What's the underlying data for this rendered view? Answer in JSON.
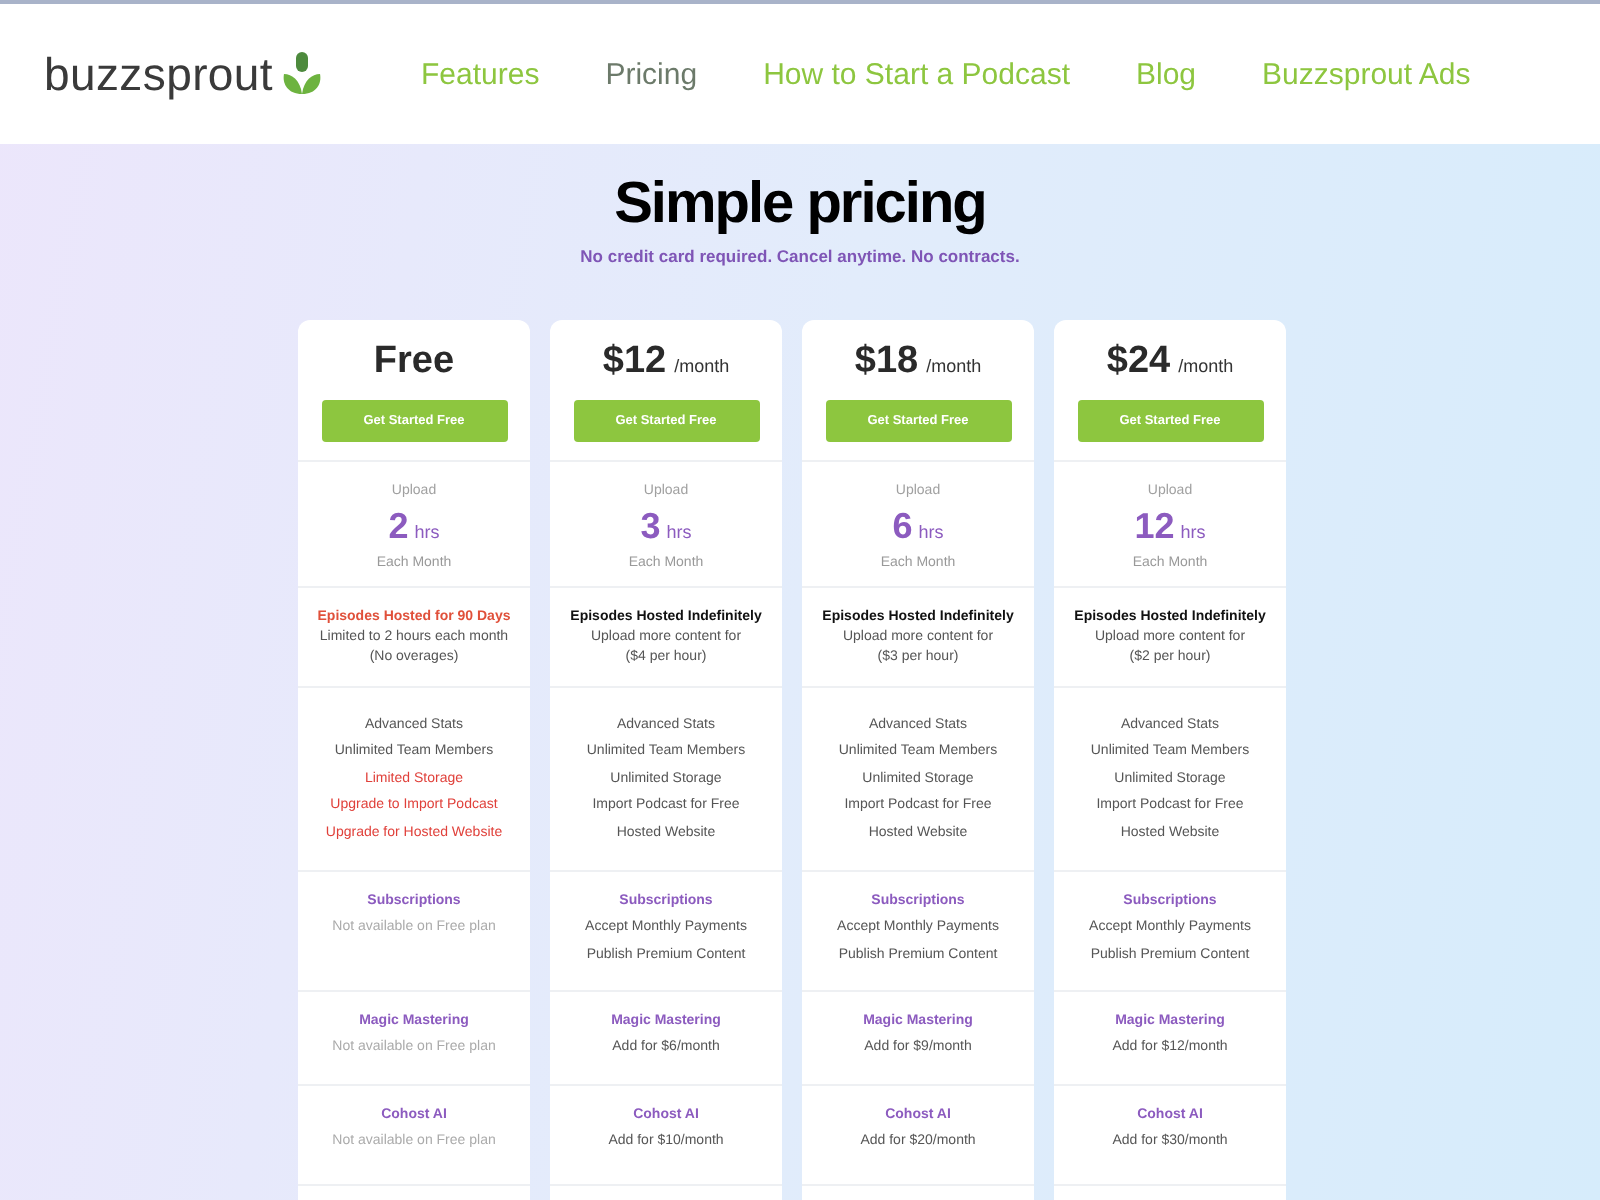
{
  "header": {
    "logo": "buzzsprout",
    "nav": [
      {
        "label": "Features",
        "selected": false
      },
      {
        "label": "Pricing",
        "selected": true
      },
      {
        "label": "How to Start a Podcast",
        "selected": false
      },
      {
        "label": "Blog",
        "selected": false
      },
      {
        "label": "Buzzsprout Ads",
        "selected": false
      }
    ]
  },
  "hero": {
    "title": "Simple pricing",
    "subtitle": "No credit card required. Cancel anytime. No contracts."
  },
  "plans": [
    {
      "price": "Free",
      "button": "Get Started Free",
      "upload": {
        "label": "Upload",
        "amount": "2",
        "unit": "hrs",
        "note": "Each Month"
      },
      "hosting": {
        "title": "Episodes Hosted for 90 Days",
        "limited": true,
        "lines": [
          "Limited to 2 hours each month",
          "(No overages)"
        ]
      },
      "features": [
        {
          "text": "Advanced Stats",
          "limited": false
        },
        {
          "text": "Unlimited Team Members",
          "limited": false
        },
        {
          "text": "Limited Storage",
          "limited": true
        },
        {
          "text": "Upgrade to Import Podcast",
          "limited": true
        },
        {
          "text": "Upgrade for Hosted Website",
          "limited": true
        }
      ],
      "addons": [
        {
          "title": "Subscriptions",
          "lines": [
            {
              "text": "Not available on Free plan",
              "available": false
            }
          ]
        },
        {
          "title": "Magic Mastering",
          "lines": [
            {
              "text": "Not available on Free plan",
              "available": false
            }
          ]
        },
        {
          "title": "Cohost AI",
          "lines": [
            {
              "text": "Not available on Free plan",
              "available": false
            }
          ]
        }
      ]
    },
    {
      "price": "$12",
      "period": "/month",
      "button": "Get Started Free",
      "upload": {
        "label": "Upload",
        "amount": "3",
        "unit": "hrs",
        "note": "Each Month"
      },
      "hosting": {
        "title": "Episodes Hosted Indefinitely",
        "limited": false,
        "lines": [
          "Upload more content for",
          "($4 per hour)"
        ]
      },
      "features": [
        {
          "text": "Advanced Stats",
          "limited": false
        },
        {
          "text": "Unlimited Team Members",
          "limited": false
        },
        {
          "text": "Unlimited Storage",
          "limited": false
        },
        {
          "text": "Import Podcast for Free",
          "limited": false
        },
        {
          "text": "Hosted Website",
          "limited": false
        }
      ],
      "addons": [
        {
          "title": "Subscriptions",
          "lines": [
            {
              "text": "Accept Monthly Payments",
              "available": true
            },
            {
              "text": "Publish Premium Content",
              "available": true
            }
          ]
        },
        {
          "title": "Magic Mastering",
          "lines": [
            {
              "text": "Add for $6/month",
              "available": true
            }
          ]
        },
        {
          "title": "Cohost AI",
          "lines": [
            {
              "text": "Add for $10/month",
              "available": true
            }
          ]
        }
      ]
    },
    {
      "price": "$18",
      "period": "/month",
      "button": "Get Started Free",
      "upload": {
        "label": "Upload",
        "amount": "6",
        "unit": "hrs",
        "note": "Each Month"
      },
      "hosting": {
        "title": "Episodes Hosted Indefinitely",
        "limited": false,
        "lines": [
          "Upload more content for",
          "($3 per hour)"
        ]
      },
      "features": [
        {
          "text": "Advanced Stats",
          "limited": false
        },
        {
          "text": "Unlimited Team Members",
          "limited": false
        },
        {
          "text": "Unlimited Storage",
          "limited": false
        },
        {
          "text": "Import Podcast for Free",
          "limited": false
        },
        {
          "text": "Hosted Website",
          "limited": false
        }
      ],
      "addons": [
        {
          "title": "Subscriptions",
          "lines": [
            {
              "text": "Accept Monthly Payments",
              "available": true
            },
            {
              "text": "Publish Premium Content",
              "available": true
            }
          ]
        },
        {
          "title": "Magic Mastering",
          "lines": [
            {
              "text": "Add for $9/month",
              "available": true
            }
          ]
        },
        {
          "title": "Cohost AI",
          "lines": [
            {
              "text": "Add for $20/month",
              "available": true
            }
          ]
        }
      ]
    },
    {
      "price": "$24",
      "period": "/month",
      "button": "Get Started Free",
      "upload": {
        "label": "Upload",
        "amount": "12",
        "unit": "hrs",
        "note": "Each Month"
      },
      "hosting": {
        "title": "Episodes Hosted Indefinitely",
        "limited": false,
        "lines": [
          "Upload more content for",
          "($2 per hour)"
        ]
      },
      "features": [
        {
          "text": "Advanced Stats",
          "limited": false
        },
        {
          "text": "Unlimited Team Members",
          "limited": false
        },
        {
          "text": "Unlimited Storage",
          "limited": false
        },
        {
          "text": "Import Podcast for Free",
          "limited": false
        },
        {
          "text": "Hosted Website",
          "limited": false
        }
      ],
      "addons": [
        {
          "title": "Subscriptions",
          "lines": [
            {
              "text": "Accept Monthly Payments",
              "available": true
            },
            {
              "text": "Publish Premium Content",
              "available": true
            }
          ]
        },
        {
          "title": "Magic Mastering",
          "lines": [
            {
              "text": "Add for $12/month",
              "available": true
            }
          ]
        },
        {
          "title": "Cohost AI",
          "lines": [
            {
              "text": "Add for $30/month",
              "available": true
            }
          ]
        }
      ]
    }
  ]
}
